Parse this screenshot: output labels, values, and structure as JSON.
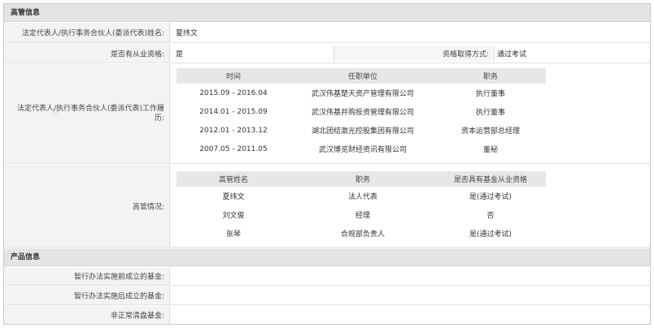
{
  "section_manager": {
    "title": "高管信息",
    "legal_rep_name": {
      "label": "法定代表人/执行事务合伙人(委派代表)姓名:",
      "value": "夏纬文"
    },
    "qualification": {
      "label": "是否有从业资格:",
      "value": "是",
      "method_label": "资格取得方式:",
      "method_value": "通过考试"
    },
    "work_history": {
      "label_line1": "法定代表人/执行事务合伙人(委派代表)工作履",
      "label_line2": "历:",
      "headers": [
        "时间",
        "任职单位",
        "职务"
      ],
      "rows": [
        [
          "2015.09 - 2016.04",
          "武汉伟基楚天资产管理有限公司",
          "执行董事"
        ],
        [
          "2014.01 - 2015.09",
          "武汉伟基并购投资管理有限公司",
          "执行董事"
        ],
        [
          "2012.01 - 2013.12",
          "湖北团结激光控股集团有限公司",
          "资本运营部总经理"
        ],
        [
          "2007.05 - 2011.05",
          "武汉博览财经资讯有限公司",
          "董秘"
        ]
      ]
    },
    "executives": {
      "label": "高管情况:",
      "headers": [
        "高管姓名",
        "职务",
        "是否具有基金从业资格"
      ],
      "rows": [
        [
          "夏纬文",
          "法人代表",
          "是(通过考试)"
        ],
        [
          "刘文俊",
          "经理",
          "否"
        ],
        [
          "张琴",
          "合规部负责人",
          "是(通过考试)"
        ]
      ]
    }
  },
  "section_product": {
    "title": "产品信息",
    "rows": [
      {
        "label": "暂行办法实施前成立的基金:",
        "value": ""
      },
      {
        "label": "暂行办法实施后成立的基金:",
        "value": ""
      },
      {
        "label": "非正常清盘基金:",
        "value": ""
      }
    ]
  }
}
